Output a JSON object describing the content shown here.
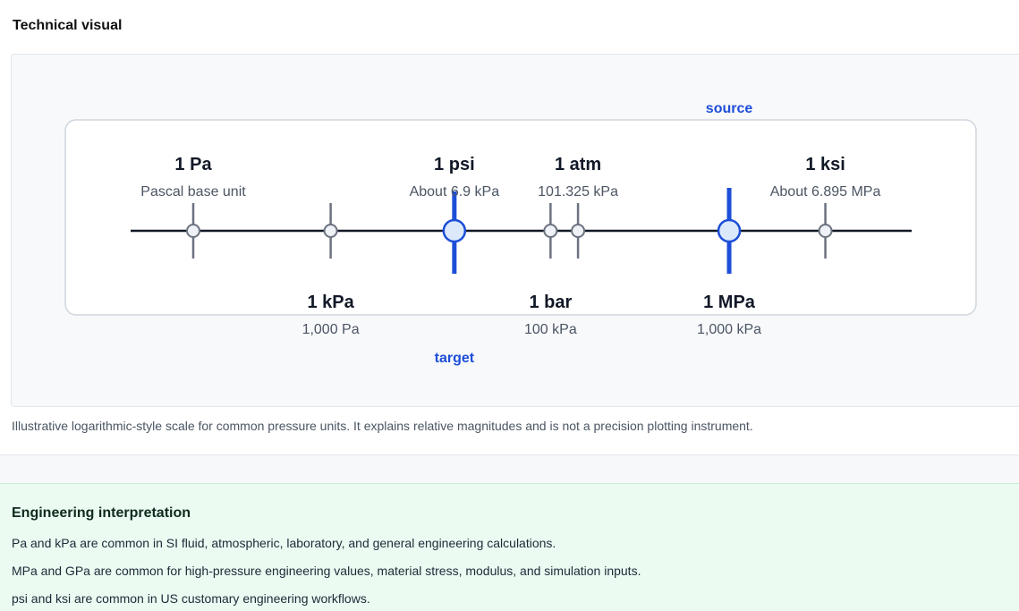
{
  "section": {
    "title": "Technical visual"
  },
  "scale": {
    "role_labels": {
      "source": "source",
      "target": "target"
    },
    "units": [
      {
        "name": "1 Pa",
        "desc": "Pascal base unit",
        "pos": 0,
        "side": "top",
        "role": ""
      },
      {
        "name": "1 kPa",
        "desc": "1,000 Pa",
        "pos": 0.2,
        "side": "bottom",
        "role": ""
      },
      {
        "name": "1 psi",
        "desc": "About 6.9 kPa",
        "pos": 0.38,
        "side": "top",
        "role": "target"
      },
      {
        "name": "1 bar",
        "desc": "100 kPa",
        "pos": 0.52,
        "side": "bottom",
        "role": ""
      },
      {
        "name": "1 atm",
        "desc": "101.325 kPa",
        "pos": 0.56,
        "side": "top",
        "role": ""
      },
      {
        "name": "1 MPa",
        "desc": "1,000 kPa",
        "pos": 0.78,
        "side": "bottom",
        "role": "source"
      },
      {
        "name": "1 ksi",
        "desc": "About 6.895 MPa",
        "pos": 0.92,
        "side": "top",
        "role": ""
      }
    ],
    "colors": {
      "axis": "#111827",
      "tick": "#6b7280",
      "highlight": "#1d4ed8",
      "highlight_fill": "#dbe9fb",
      "node_fill": "#eef1f5"
    }
  },
  "caption": "Illustrative logarithmic-style scale for common pressure units. It explains relative magnitudes and is not a precision plotting instrument.",
  "interpretation": {
    "title": "Engineering interpretation",
    "lines": [
      "Pa and kPa are common in SI fluid, atmospheric, laboratory, and general engineering calculations.",
      "MPa and GPa are common for high-pressure engineering values, material stress, modulus, and simulation inputs.",
      "psi and ksi are common in US customary engineering workflows."
    ]
  }
}
